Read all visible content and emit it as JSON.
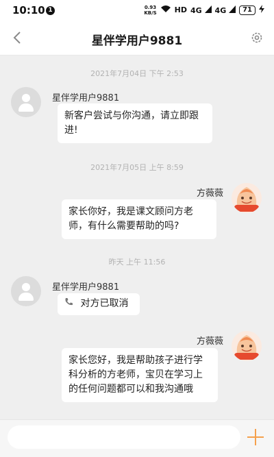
{
  "status_bar": {
    "time": "10:10",
    "notification_count": "1",
    "net_speed_value": "0.93",
    "net_speed_unit": "KB/S",
    "hd_label": "HD",
    "signal1_label": "4G",
    "signal2_label": "4G",
    "battery": "71"
  },
  "header": {
    "title": "星伴学用户9881"
  },
  "messages": [
    {
      "timestamp": "2021年7月04日 下午 2:53",
      "sender": "星伴学用户9881",
      "side": "left",
      "text": "新客户尝试与你沟通，请立即跟进!",
      "text_line1": "新客户尝试与你沟通，请立即跟",
      "text_line2": "进!"
    },
    {
      "timestamp": "2021年7月05日 上午 8:59",
      "sender": "方薇薇",
      "side": "right",
      "text_line1": "家长你好，我是课文顾问方老",
      "text_line2": "师，有什么需要帮助的吗?"
    },
    {
      "timestamp": "昨天 上午 11:56",
      "sender": "星伴学用户9881",
      "side": "left",
      "call_status": "对方已取消"
    },
    {
      "sender": "方薇薇",
      "side": "right",
      "text_line1": "家长您好，我是帮助孩子进行学",
      "text_line2": "科分析的方老师，宝贝在学习上",
      "text_line3": "的任何问题都可以和我沟通哦"
    }
  ],
  "input": {
    "placeholder": ""
  },
  "colors": {
    "accent": "#f5a04c",
    "background": "#efefef"
  }
}
